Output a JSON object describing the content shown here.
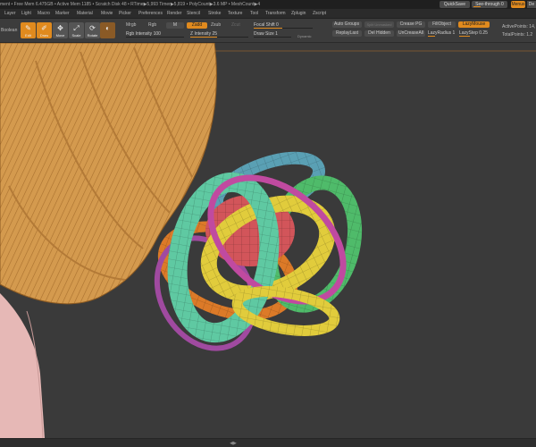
{
  "status": {
    "text": "ment • Free Mem 6.475GB • Active Mem 1185 • Scratch Disk 48 • RTime▶5,993 Timer▶5,819 • PolyCount▶3.6 MP • MeshCount▶4",
    "quicksave": "QuickSave",
    "seethrough": "See-through 0",
    "menus": "Menus",
    "default": "De"
  },
  "menu": {
    "items": [
      "Layer",
      "Light",
      "Macro",
      "Marker",
      "Material",
      "Movie",
      "Picker",
      "Preferences",
      "Render",
      "Stencil",
      "Stroke",
      "Texture",
      "Tool",
      "Transform",
      "Zplugin",
      "Zscript"
    ]
  },
  "toolbar": {
    "boolean": "Boolean",
    "edit": "Edit",
    "draw": "Draw",
    "move": "Move",
    "scale": "Scale",
    "rotate": "Rotate",
    "mrgb": "Mrgb",
    "rgb": "Rgb",
    "m": "M",
    "zadd": "Zadd",
    "zsub": "Zsub",
    "zcut": "Zcut",
    "rgb_intensity": "Rgb Intensity 100",
    "z_intensity": "Z Intensity 25",
    "focal_shift": "Focal Shift 0",
    "draw_size": "Draw Size 1",
    "dynamic": "Dynamic",
    "auto_groups": "Auto Groups",
    "split_unmasked": "Split Unmasked",
    "crease_pg": "Crease PG",
    "fill_object": "FillObject",
    "lazy_mouse": "LazyMouse",
    "replay_last": "ReplayLast",
    "del_hidden": "Del Hidden",
    "uncrease_all": "UnCreaseAll",
    "lazy_radius": "LazyRadius 1",
    "lazy_step": "LazyStep 0.25",
    "active_points": "ActivePoints: 14,",
    "total_points": "TotalPoints: 1.2"
  },
  "colors": {
    "accent": "#e08a1e",
    "hair": "#d49a4e",
    "skin": "#e6b8b6",
    "group_teal": "#5fc9a2",
    "group_yellow": "#e1cc3c",
    "group_magenta": "#c04aa0",
    "group_blue": "#5aa0b4",
    "group_green": "#4fbb6a",
    "group_red": "#d2555a",
    "group_orange": "#dc7a28"
  }
}
